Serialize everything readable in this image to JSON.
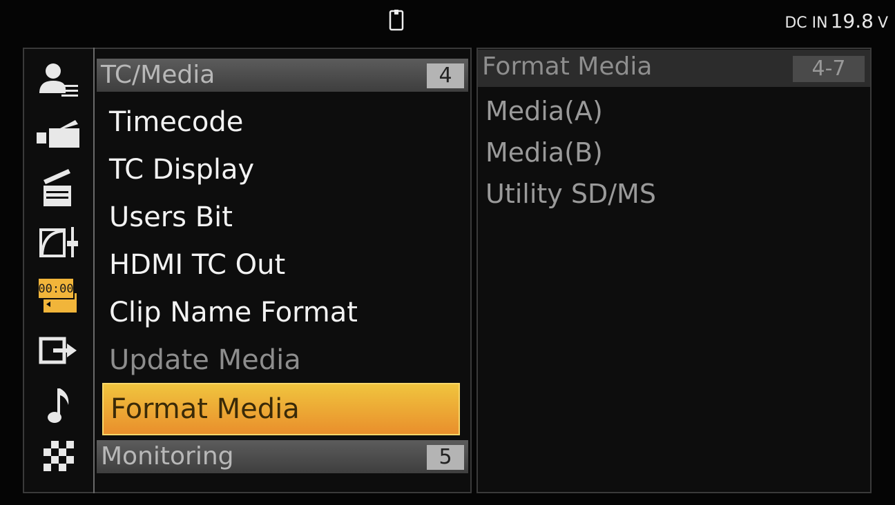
{
  "status_bar": {
    "media_icon": "media-card-icon",
    "power_label": "DC IN",
    "power_value": "19.8",
    "power_unit": "V"
  },
  "category_icons": [
    {
      "name": "user-menu-icon",
      "selected": false
    },
    {
      "name": "camera-icon",
      "selected": false
    },
    {
      "name": "clapperboard-icon",
      "selected": false
    },
    {
      "name": "paint-levels-icon",
      "selected": false
    },
    {
      "name": "timecode-media-icon",
      "selected": true,
      "label": "00:00",
      "color": "#f1b53a"
    },
    {
      "name": "output-icon",
      "selected": false
    },
    {
      "name": "music-note-icon",
      "selected": false
    },
    {
      "name": "checker-icon",
      "selected": false
    }
  ],
  "menu": {
    "section_title": "TC/Media",
    "section_number": "4",
    "items": [
      {
        "label": "Timecode",
        "state": "normal"
      },
      {
        "label": "TC Display",
        "state": "normal"
      },
      {
        "label": "Users Bit",
        "state": "normal"
      },
      {
        "label": "HDMI TC Out",
        "state": "normal"
      },
      {
        "label": "Clip Name Format",
        "state": "normal"
      },
      {
        "label": "Update Media",
        "state": "disabled"
      },
      {
        "label": "Format Media",
        "state": "selected"
      }
    ],
    "next_section_title": "Monitoring",
    "next_section_number": "5"
  },
  "submenu": {
    "title": "Format Media",
    "number": "4-7",
    "items": [
      "Media(A)",
      "Media(B)",
      "Utility SD/MS"
    ]
  },
  "colors": {
    "selected_highlight_top": "#f0c43e",
    "selected_highlight_bottom": "#e98f2c",
    "text_normal": "#f2f2f2",
    "text_disabled": "#8d8d8d"
  }
}
